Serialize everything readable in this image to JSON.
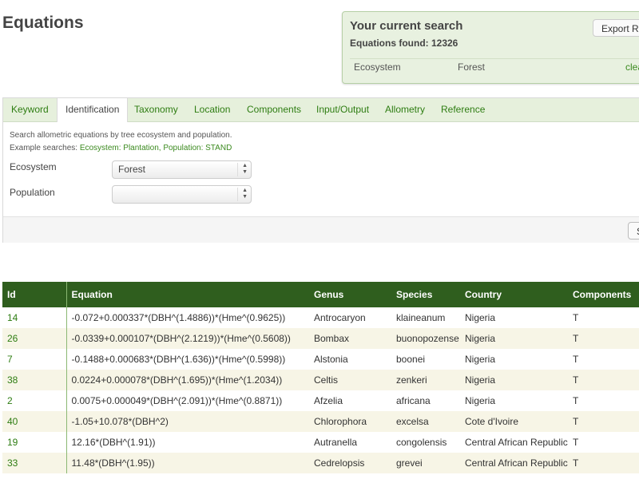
{
  "page": {
    "title": "Equations"
  },
  "current_search": {
    "title": "Your current search",
    "found_label": "Equations found: 12326",
    "export_label": "Export Results",
    "filter_key": "Ecosystem",
    "filter_value": "Forest",
    "clear_label": "clear"
  },
  "tabs": [
    {
      "label": "Keyword"
    },
    {
      "label": "Identification"
    },
    {
      "label": "Taxonomy"
    },
    {
      "label": "Location"
    },
    {
      "label": "Components"
    },
    {
      "label": "Input/Output"
    },
    {
      "label": "Allometry"
    },
    {
      "label": "Reference"
    }
  ],
  "active_tab": "Identification",
  "identification": {
    "help_text": "Search allometric equations by tree ecosystem and population.",
    "example_prefix": "Example searches: ",
    "example_links": "Ecosystem: Plantation, Population: STAND",
    "ecosystem_label": "Ecosystem",
    "ecosystem_value": "Forest",
    "population_label": "Population",
    "population_value": "",
    "search_button": "Search"
  },
  "table": {
    "headers": [
      "Id",
      "Equation",
      "Genus",
      "Species",
      "Country",
      "Components"
    ],
    "rows": [
      [
        "14",
        "-0.072+0.000337*(DBH^(1.4886))*(Hme^(0.9625))",
        "Antrocaryon",
        "klaineanum",
        "Nigeria",
        "T"
      ],
      [
        "26",
        "-0.0339+0.000107*(DBH^(2.1219))*(Hme^(0.5608))",
        "Bombax",
        "buonopozense",
        "Nigeria",
        "T"
      ],
      [
        "7",
        "-0.1488+0.000683*(DBH^(1.636))*(Hme^(0.5998))",
        "Alstonia",
        "boonei",
        "Nigeria",
        "T"
      ],
      [
        "38",
        "0.0224+0.000078*(DBH^(1.695))*(Hme^(1.2034))",
        "Celtis",
        "zenkeri",
        "Nigeria",
        "T"
      ],
      [
        "2",
        "0.0075+0.000049*(DBH^(2.091))*(Hme^(0.8871))",
        "Afzelia",
        "africana",
        "Nigeria",
        "T"
      ],
      [
        "40",
        "-1.05+10.078*(DBH^2)",
        "Chlorophora",
        "excelsa",
        "Cote d'Ivoire",
        "T"
      ],
      [
        "19",
        "12.16*(DBH^(1.91))",
        "Autranella",
        "congolensis",
        "Central African Republic",
        "T"
      ],
      [
        "33",
        "11.48*(DBH^(1.95))",
        "Cedrelopsis",
        "grevei",
        "Central African Republic",
        "T"
      ]
    ]
  }
}
